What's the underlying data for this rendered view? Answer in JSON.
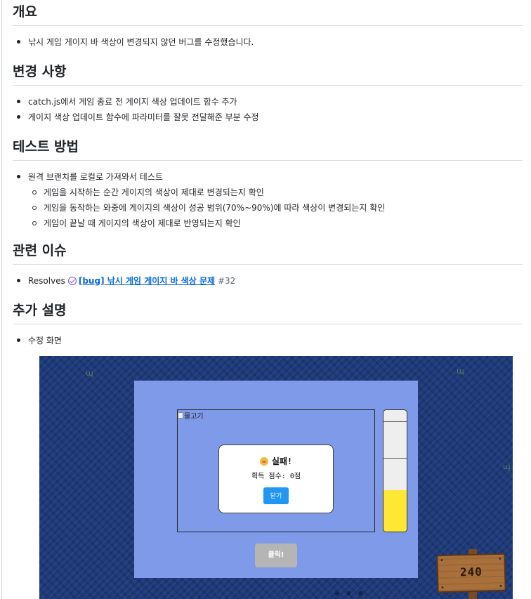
{
  "sections": {
    "overview": {
      "heading": "개요",
      "items": [
        "낚시 게임 게이지 바 색상이 변경되지 않던 버그를 수정했습니다."
      ]
    },
    "changes": {
      "heading": "변경 사항",
      "items": [
        "catch.js에서 게임 종료 전 게이지 색상 업데이트 함수 추가",
        "게이지 색상 업데이트 함수에 파라미터를 잘못 전달해준 부분 수정"
      ]
    },
    "test": {
      "heading": "테스트 방법",
      "item": "원격 브랜치를 로컬로 가져와서 테스트",
      "subitems": [
        "게임을 시작하는 순간 게이지의 색상이 제대로 변경되는지 확인",
        "게임을 동작하는 와중에 게이지의 색상이 성공 범위(70%~90%)에 따라 색상이 변경되는지 확인",
        "게임이 끝날 때 게이지의 색상이 제대로 반영되는지 확인"
      ]
    },
    "related": {
      "heading": "관련 이슈",
      "prefix": "Resolves",
      "issue_title": "[bug] 낚시 게임 게이지 바 색상 문제",
      "issue_number": "#32"
    },
    "extra": {
      "heading": "추가 설명",
      "item": "수정 화면"
    }
  },
  "game": {
    "fish_alt": "물고기",
    "modal_title": "실패!",
    "modal_score": "획득 점수: 0점",
    "close_label": "닫기",
    "click_label": "클릭!",
    "sign_value": "240",
    "gauge_fill_fraction": 0.34,
    "colors": {
      "gauge_fill": "#ffe835",
      "panel": "#7f9ae8",
      "close_button": "#2196f3",
      "water": "#1e3a7a"
    }
  }
}
